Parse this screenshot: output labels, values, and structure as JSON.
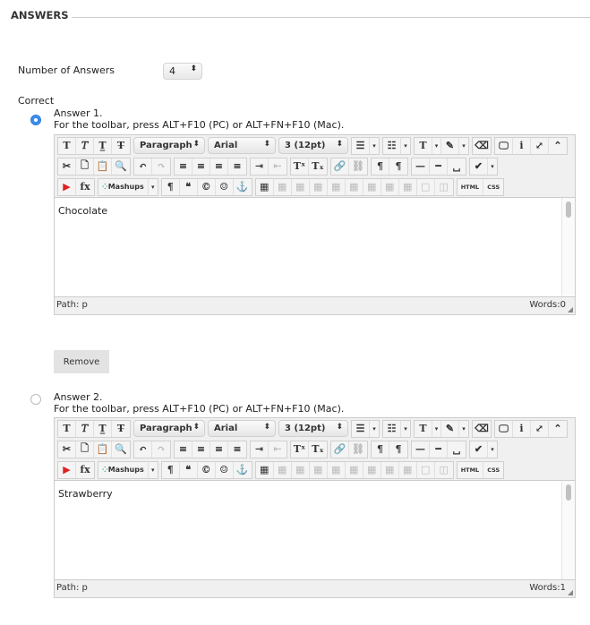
{
  "section_title": "ANSWERS",
  "num_answers": {
    "label": "Number of Answers",
    "value": "4"
  },
  "correct_label": "Correct",
  "toolbar_hint": "For the toolbar, press ALT+F10 (PC) or ALT+FN+F10 (Mac).",
  "format_dropdowns": {
    "paragraph": "Paragraph",
    "font": "Arial",
    "size": "3 (12pt)"
  },
  "mashups_label": "Mashups",
  "path_label": "Path: p",
  "remove_label": "Remove",
  "accent_color": "#3b8ced",
  "answers": [
    {
      "label": "Answer 1.",
      "text": "Chocolate",
      "words": "Words:0",
      "correct": true
    },
    {
      "label": "Answer 2.",
      "text": "Strawberry",
      "words": "Words:1",
      "correct": false
    }
  ]
}
